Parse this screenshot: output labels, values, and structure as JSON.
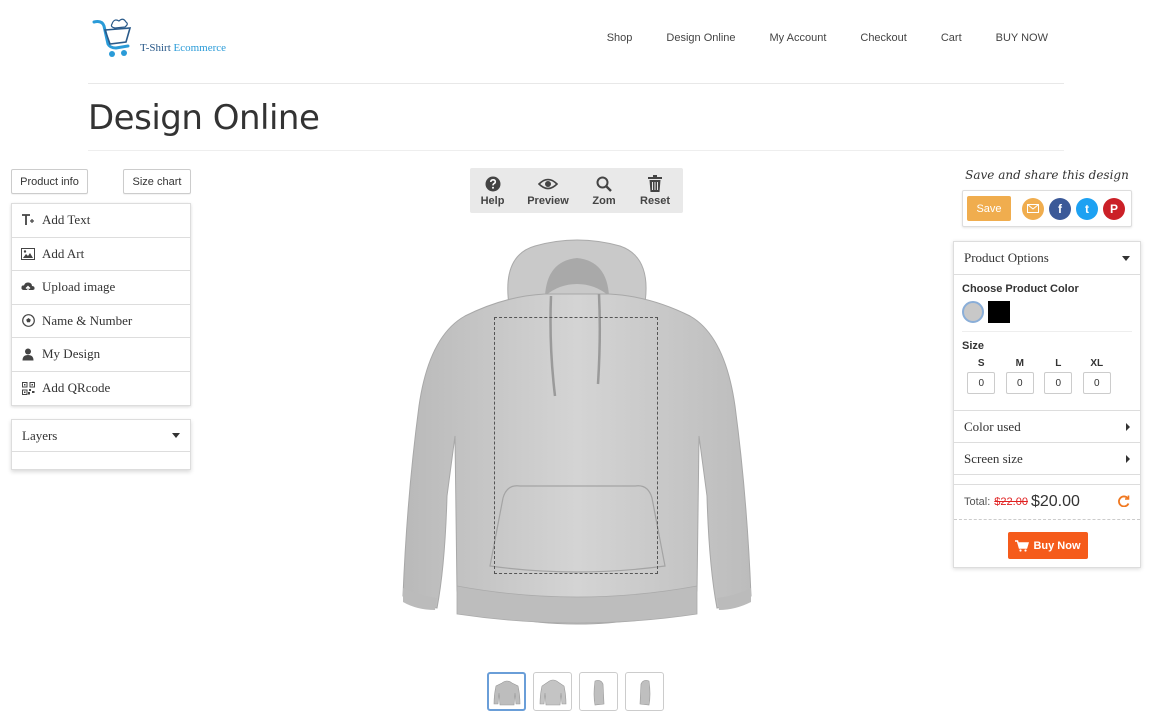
{
  "brand": {
    "name_part1": "T-Shirt",
    "name_part2": "Ecommerce"
  },
  "nav": {
    "items": [
      "Shop",
      "Design Online",
      "My Account",
      "Checkout",
      "Cart",
      "BUY NOW"
    ]
  },
  "page": {
    "title": "Design Online"
  },
  "left_panel": {
    "product_info_label": "Product info",
    "size_chart_label": "Size chart",
    "tools": [
      {
        "label": "Add Text",
        "icon": "text-icon"
      },
      {
        "label": "Add Art",
        "icon": "image-icon"
      },
      {
        "label": "Upload image",
        "icon": "upload-cloud-icon"
      },
      {
        "label": "Name & Number",
        "icon": "soccer-ball-icon"
      },
      {
        "label": "My Design",
        "icon": "user-icon"
      },
      {
        "label": "Add QRcode",
        "icon": "qrcode-icon"
      }
    ],
    "layers_label": "Layers"
  },
  "toolbar": {
    "help_label": "Help",
    "preview_label": "Preview",
    "zoom_label": "Zom",
    "reset_label": "Reset"
  },
  "share": {
    "title": "Save and share this design",
    "save_label": "Save",
    "facebook_glyph": "f",
    "twitter_glyph": "t",
    "pinterest_glyph": "P"
  },
  "options": {
    "header": "Product Options",
    "color_label": "Choose Product Color",
    "colors": [
      {
        "name": "heather-gray",
        "hex": "#c8c8c8",
        "selected": true
      },
      {
        "name": "black",
        "hex": "#000000",
        "selected": false
      }
    ],
    "size_label": "Size",
    "sizes": [
      {
        "label": "S",
        "value": "0"
      },
      {
        "label": "M",
        "value": "0"
      },
      {
        "label": "L",
        "value": "0"
      },
      {
        "label": "XL",
        "value": "0"
      }
    ],
    "color_used_label": "Color used",
    "screen_size_label": "Screen size",
    "total_label": "Total:",
    "old_price": "$22.00",
    "new_price": "$20.00",
    "buy_now_label": "Buy Now"
  },
  "colors": {
    "save_orange": "#f0ad4e",
    "buy_orange": "#f55b1b",
    "facebook": "#3b5998",
    "twitter": "#1da1f2",
    "pinterest": "#cb2027",
    "email": "#f0ad4e"
  }
}
